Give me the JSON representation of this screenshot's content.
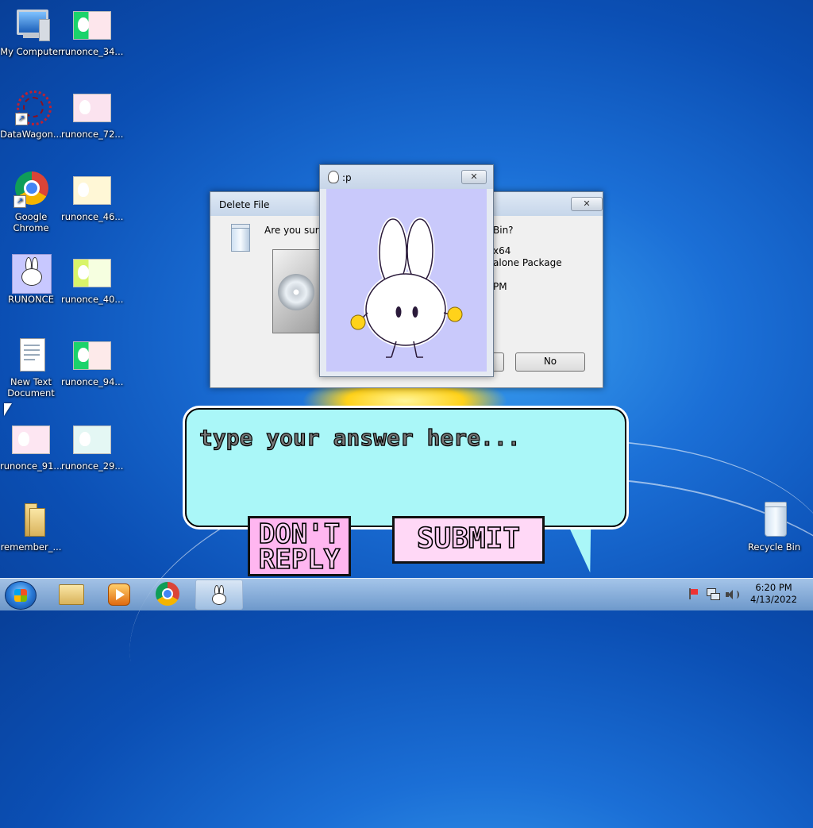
{
  "desktop": {
    "icons": [
      {
        "label": "My Computer"
      },
      {
        "label": "runonce_34..."
      },
      {
        "label": "DataWagon..."
      },
      {
        "label": "runonce_72..."
      },
      {
        "label": "Google Chrome"
      },
      {
        "label": "runonce_46..."
      },
      {
        "label": "RUNONCE"
      },
      {
        "label": "runonce_40..."
      },
      {
        "label": "New Text Document"
      },
      {
        "label": "runonce_94..."
      },
      {
        "label": "runonce_91..."
      },
      {
        "label": "runonce_29..."
      },
      {
        "label": "remember_..."
      },
      {
        "label": "Recycle Bin"
      }
    ]
  },
  "delete_dialog": {
    "title": "Delete File",
    "question_visible": "Are you sure",
    "question_tail": "Bin?",
    "detail_line1": "x64",
    "detail_line2": "alone Package",
    "detail_line3": "PM",
    "no_label": "No",
    "close_glyph": "✕"
  },
  "bunny_window": {
    "title": ":p",
    "close_glyph": "✕",
    "bg_color": "#c9c9fb"
  },
  "bubble": {
    "placeholder": "type your answer here...",
    "dont_reply_line1": "DON'T",
    "dont_reply_line2": "REPLY",
    "submit_label": "SUBMIT",
    "color": "#aaf7f8"
  },
  "taskbar": {
    "time": "6:20 PM",
    "date": "4/13/2022"
  }
}
